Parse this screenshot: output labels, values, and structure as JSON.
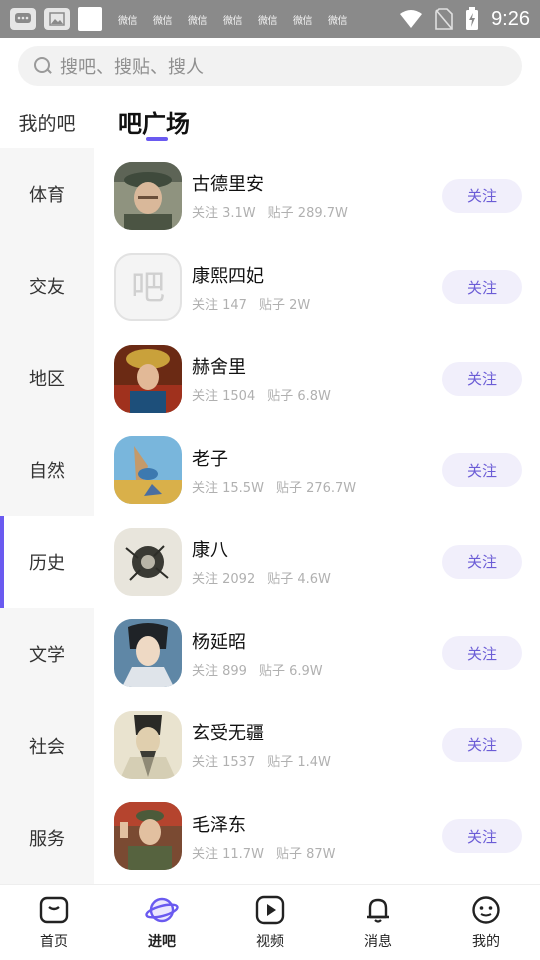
{
  "status_bar": {
    "note_text": "微信",
    "time": "9:26"
  },
  "search": {
    "placeholder": "搜吧、搜贴、搜人"
  },
  "sidebar": {
    "mine_label": "我的吧",
    "items": [
      {
        "label": "体育",
        "active": false
      },
      {
        "label": "交友",
        "active": false
      },
      {
        "label": "地区",
        "active": false
      },
      {
        "label": "自然",
        "active": false
      },
      {
        "label": "历史",
        "active": true
      },
      {
        "label": "文学",
        "active": false
      },
      {
        "label": "社会",
        "active": false
      },
      {
        "label": "服务",
        "active": false
      }
    ]
  },
  "main": {
    "title": "吧广场",
    "follow_label": "关注",
    "bars": [
      {
        "name": "古德里安",
        "followers": "关注 3.1W",
        "posts": "贴子 289.7W",
        "avatar": "portrait-military"
      },
      {
        "name": "康熙四妃",
        "followers": "关注 147",
        "posts": "贴子 2W",
        "avatar": "placeholder-ba",
        "glyph": "吧"
      },
      {
        "name": "赫舍里",
        "followers": "关注 1504",
        "posts": "贴子 6.8W",
        "avatar": "portrait-qing"
      },
      {
        "name": "老子",
        "followers": "关注 15.5W",
        "posts": "贴子 276.7W",
        "avatar": "painting-sky"
      },
      {
        "name": "康八",
        "followers": "关注 2092",
        "posts": "贴子 4.6W",
        "avatar": "ink-drawing"
      },
      {
        "name": "杨延昭",
        "followers": "关注 899",
        "posts": "贴子 6.9W",
        "avatar": "portrait-general"
      },
      {
        "name": "玄受无疆",
        "followers": "关注 1537",
        "posts": "贴子 1.4W",
        "avatar": "portrait-scholar"
      },
      {
        "name": "毛泽东",
        "followers": "关注 11.7W",
        "posts": "贴子 87W",
        "avatar": "portrait-leader"
      }
    ]
  },
  "bottom_nav": [
    {
      "label": "首页",
      "icon": "home-icon",
      "active": false
    },
    {
      "label": "进吧",
      "icon": "planet-icon",
      "active": true
    },
    {
      "label": "视频",
      "icon": "video-icon",
      "active": false
    },
    {
      "label": "消息",
      "icon": "bell-icon",
      "active": false
    },
    {
      "label": "我的",
      "icon": "profile-icon",
      "active": false
    }
  ],
  "colors": {
    "accent": "#6a5af0",
    "follow_bg": "#f1effb",
    "follow_text": "#6b5cd6",
    "sidebar_bg": "#f6f6f6"
  }
}
